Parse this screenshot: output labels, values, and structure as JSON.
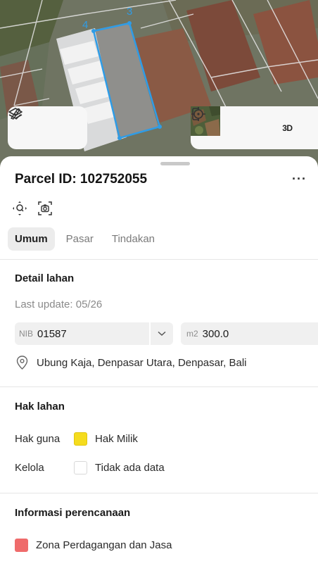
{
  "map": {
    "vertex_labels": [
      "4",
      "3"
    ],
    "thumbnail_icon": "satellite-thumbnail",
    "buttons": {
      "layers_icon": "layers-icon",
      "measure_icon": "measure-icon",
      "locate_icon": "locate-icon",
      "three_d_label": "3D"
    }
  },
  "parcel": {
    "title": "Parcel ID: 102752055",
    "more_label": "···"
  },
  "tabs": [
    {
      "label": "Umum",
      "active": true
    },
    {
      "label": "Pasar",
      "active": false
    },
    {
      "label": "Tindakan",
      "active": false
    }
  ],
  "detail": {
    "heading": "Detail lahan",
    "last_update": "Last update: 05/26",
    "nib_prefix": "NIB",
    "nib_value": "01587",
    "area_prefix": "m2",
    "area_value": "300.0",
    "address": "Ubung Kaja, Denpasar Utara, Denpasar, Bali"
  },
  "rights": {
    "heading": "Hak lahan",
    "rows": [
      {
        "label": "Hak guna",
        "value": "Hak Milik",
        "color": "#f5dc1e"
      },
      {
        "label": "Kelola",
        "value": "Tidak ada data",
        "color": "#ffffff"
      }
    ]
  },
  "planning": {
    "heading": "Informasi perencanaan",
    "zone": "Zona Perdagangan dan Jasa",
    "zone_color": "#ef6b6b"
  },
  "colors": {
    "parcel_outline": "#2f9ce6",
    "accent": "#2f9ce6"
  }
}
